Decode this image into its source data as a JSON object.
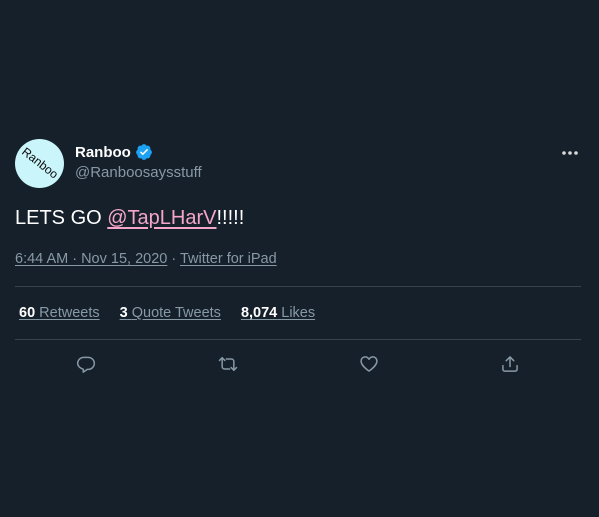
{
  "tweet": {
    "avatar_text": "Ranboo",
    "display_name": "Ranboo",
    "handle": "@Ranboosaysstuff",
    "text_before": "LETS GO ",
    "mention": "@TapLHarV",
    "text_after": "!!!!!",
    "time": "6:44 AM · Nov 15, 2020",
    "separator": " · ",
    "source": "Twitter for iPad"
  },
  "stats": {
    "retweets_count": "60",
    "retweets_label": "Retweets",
    "quotes_count": "3",
    "quotes_label": "Quote Tweets",
    "likes_count": "8,074",
    "likes_label": "Likes"
  },
  "icons": {
    "verified": "verified-badge-icon",
    "more": "more-dots-icon",
    "reply": "reply-icon",
    "retweet": "retweet-icon",
    "like": "heart-icon",
    "share": "share-icon"
  },
  "colors": {
    "background": "#15202b",
    "mention": "#f4a6c8",
    "secondary_text": "#8899a6",
    "verified": "#1da1f2",
    "divider": "#38444d"
  }
}
